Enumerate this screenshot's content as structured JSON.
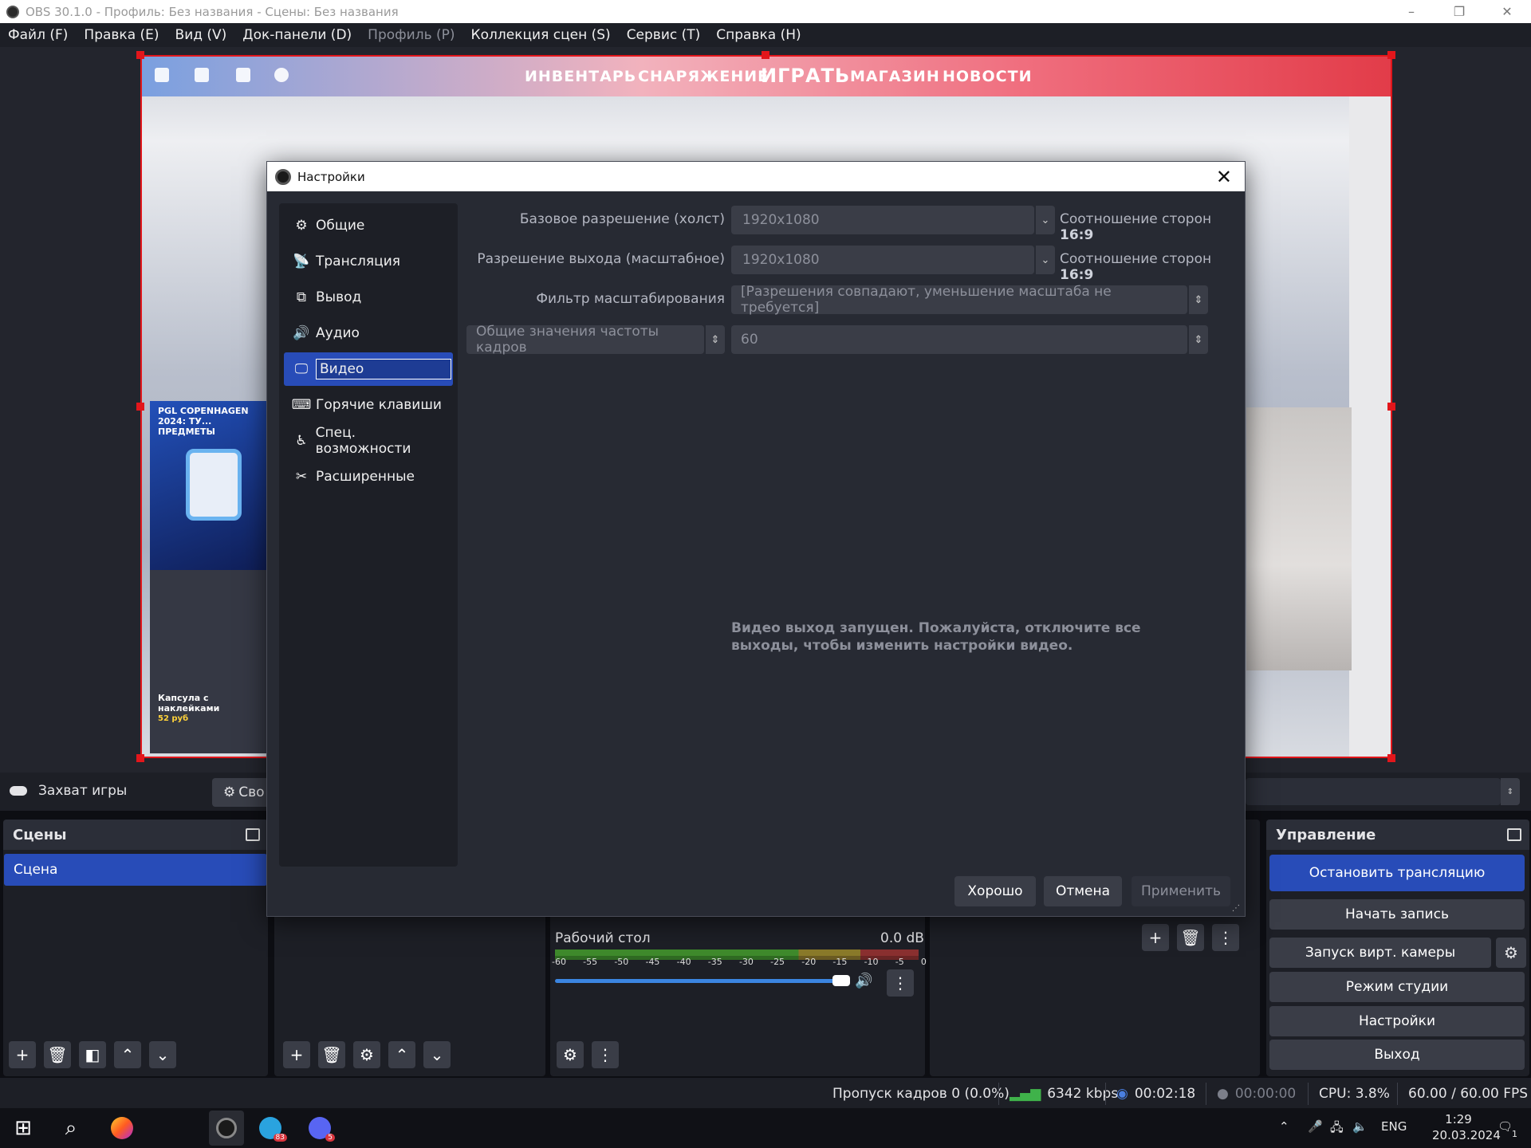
{
  "window": {
    "title": "OBS 30.1.0 - Профиль: Без названия - Сцены: Без названия",
    "controls": [
      "–",
      "❐",
      "✕"
    ]
  },
  "menu": [
    {
      "label": "Файл (F)",
      "enabled": true
    },
    {
      "label": "Правка (E)",
      "enabled": true
    },
    {
      "label": "Вид (V)",
      "enabled": true
    },
    {
      "label": "Док-панели (D)",
      "enabled": true
    },
    {
      "label": "Профиль (P)",
      "enabled": false
    },
    {
      "label": "Коллекция сцен (S)",
      "enabled": true
    },
    {
      "label": "Сервис (T)",
      "enabled": true
    },
    {
      "label": "Справка (H)",
      "enabled": true
    }
  ],
  "preview": {
    "nav": [
      "ИНВЕНТАРЬ",
      "СНАРЯЖЕНИЕ",
      "ИГРАТЬ",
      "МАГАЗИН",
      "НОВОСТИ"
    ],
    "card1_title": "PGL COPENHAGEN 2024: ТУ... ПРЕДМЕТЫ",
    "card2_title": "Капсула с наклейками",
    "card2_price": "52 руб"
  },
  "source_bar": {
    "source_name": "Захват игры",
    "properties_label": "Сво"
  },
  "scenes": {
    "title": "Сцены",
    "items": [
      "Сцена"
    ]
  },
  "controls": {
    "title": "Управление",
    "stop_stream": "Остановить трансляцию",
    "start_record": "Начать запись",
    "virtual_cam": "Запуск вирт. камеры",
    "studio_mode": "Режим студии",
    "settings": "Настройки",
    "exit": "Выход"
  },
  "mixer": {
    "channel": "Рабочий стол",
    "level": "0.0 dB",
    "ticks": [
      "-60",
      "-55",
      "-50",
      "-45",
      "-40",
      "-35",
      "-30",
      "-25",
      "-20",
      "-15",
      "-10",
      "-5",
      "0"
    ],
    "volume": 0.82
  },
  "status": {
    "dropped": "Пропуск кадров 0 (0.0%)",
    "bitrate": "6342 kbps",
    "stream_time": "00:02:18",
    "rec_time": "00:00:00",
    "cpu": "CPU: 3.8%",
    "fps": "60.00 / 60.00 FPS"
  },
  "taskbar": {
    "lang": "ENG",
    "time": "1:29",
    "date": "20.03.2024",
    "tg_badge": "83",
    "discord_badge": "5",
    "notif_badge": "1"
  },
  "settings_dialog": {
    "title": "Настройки",
    "nav": [
      {
        "label": "Общие",
        "icon": "gear-icon"
      },
      {
        "label": "Трансляция",
        "icon": "broadcast-icon"
      },
      {
        "label": "Вывод",
        "icon": "output-icon"
      },
      {
        "label": "Аудио",
        "icon": "speaker-icon"
      },
      {
        "label": "Видео",
        "icon": "monitor-icon"
      },
      {
        "label": "Горячие клавиши",
        "icon": "keyboard-icon"
      },
      {
        "label": "Спец. возможности",
        "icon": "accessibility-icon"
      },
      {
        "label": "Расширенные",
        "icon": "tools-icon"
      }
    ],
    "active_nav": "Видео",
    "base_res_label": "Базовое разрешение (холст)",
    "base_res_value": "1920x1080",
    "base_aspect_prefix": "Соотношение сторон",
    "base_aspect": "16:9",
    "output_res_label": "Разрешение выхода (масштабное)",
    "output_res_value": "1920x1080",
    "output_aspect_prefix": "Соотношение сторон",
    "output_aspect": "16:9",
    "filter_label": "Фильтр масштабирования",
    "filter_value": "[Разрешения совпадают, уменьшение масштаба не требуется]",
    "fps_type": "Общие значения частоты кадров",
    "fps_value": "60",
    "warning": "Видео выход запущен. Пожалуйста, отключите все выходы, чтобы изменить настройки видео.",
    "ok": "Хорошо",
    "cancel": "Отмена",
    "apply": "Применить"
  },
  "colors": {
    "accent": "#284cb8",
    "selection_border": "#e2161b",
    "background": "#1d1f26"
  }
}
